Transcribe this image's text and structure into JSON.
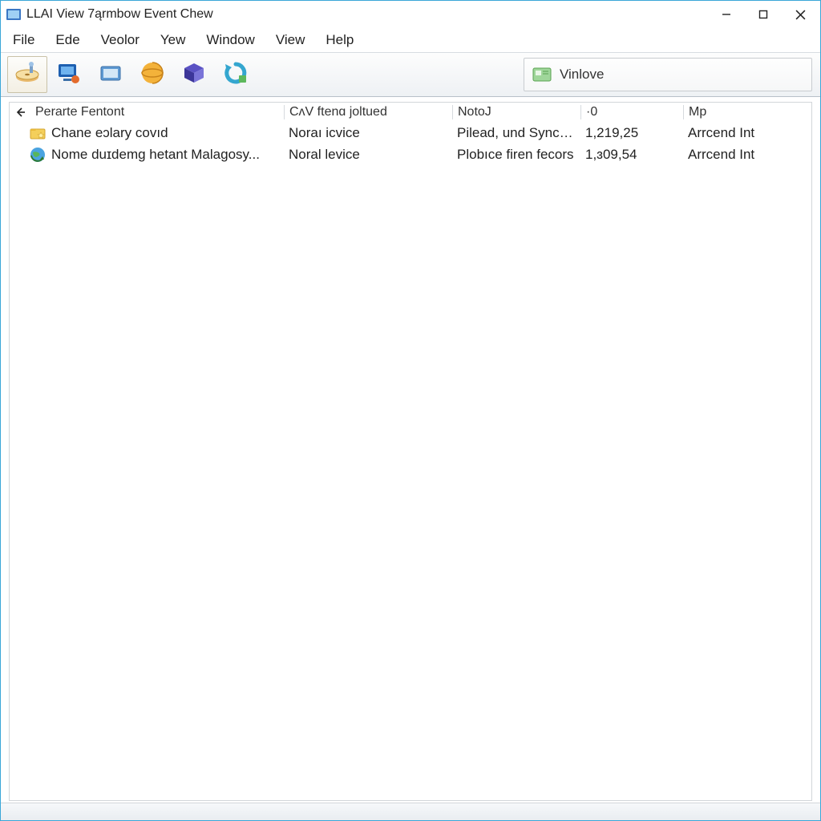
{
  "window": {
    "title": "LLAI View 7ąrmbow Event Chew"
  },
  "menu": {
    "items": [
      "File",
      "Ede",
      "Veolor",
      "Yew",
      "Window",
      "View",
      "Help"
    ]
  },
  "toolbar": {
    "icons": [
      "disk-icon",
      "computer-icon",
      "folder-icon",
      "globe-icon",
      "box-icon",
      "refresh-icon"
    ]
  },
  "search": {
    "label": "Vinlove"
  },
  "columns": [
    "Perarte Fentont",
    "CʌV ftenɑ joltued",
    "NotoJ",
    "·0",
    "Mp"
  ],
  "rows": [
    {
      "icon": "folder-star-icon",
      "c0": "Chane eɔlary covıd",
      "c1": "Noraı icvice",
      "c2": "Pilead, und Syncanl)",
      "c3": "1,219,25",
      "c4": "Arrcend Int"
    },
    {
      "icon": "globe-refresh-icon",
      "c0": "Nome duɪdemg hetant Malagosy...",
      "c1": "Noral levice",
      "c2": "Plobıce firen fecors",
      "c3": "1,ɜ09,54",
      "c4": "Arrcend Int"
    }
  ]
}
